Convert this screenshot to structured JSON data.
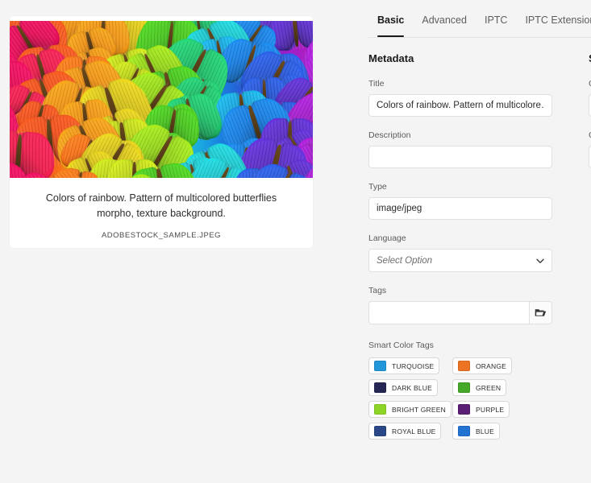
{
  "asset": {
    "caption": "Colors of rainbow. Pattern of multicolored butterflies morpho, texture background.",
    "filename": "ADOBESTOCK_SAMPLE.JPEG",
    "preview_alt": "butterfly-rainbow-pattern"
  },
  "tabs": [
    {
      "label": "Basic",
      "active": true
    },
    {
      "label": "Advanced",
      "active": false
    },
    {
      "label": "IPTC",
      "active": false
    },
    {
      "label": "IPTC Extension",
      "active": false
    }
  ],
  "metadata": {
    "section_title": "Metadata",
    "fields": {
      "title": {
        "label": "Title",
        "value": "Colors of rainbow. Pattern of multicolore…",
        "placeholder": ""
      },
      "description": {
        "label": "Description",
        "value": "",
        "placeholder": ""
      },
      "type": {
        "label": "Type",
        "value": "image/jpeg",
        "placeholder": ""
      },
      "language": {
        "label": "Language",
        "value": "Select Option"
      },
      "tags": {
        "label": "Tags",
        "value": "",
        "placeholder": "",
        "browse_icon": "folder-icon"
      }
    },
    "smart_color_tags": {
      "label": "Smart Color Tags",
      "items": [
        {
          "name": "TURQUOISE",
          "color": "#2196D8"
        },
        {
          "name": "ORANGE",
          "color": "#ED7422"
        },
        {
          "name": "DARK BLUE",
          "color": "#262654"
        },
        {
          "name": "GREEN",
          "color": "#45A829"
        },
        {
          "name": "BRIGHT GREEN",
          "color": "#8CD426"
        },
        {
          "name": "PURPLE",
          "color": "#5A1E74"
        },
        {
          "name": "ROYAL BLUE",
          "color": "#2A4887"
        },
        {
          "name": "BLUE",
          "color": "#2273D2"
        }
      ]
    }
  },
  "second_column": {
    "section_title": "S",
    "labels": [
      "C",
      "C"
    ]
  },
  "theme": {
    "page_bg": "#f4f4f4",
    "card_bg": "#ffffff",
    "accent": "#1a1a1a",
    "label_color": "#5c5c5c",
    "border": "#e0e0e0"
  }
}
